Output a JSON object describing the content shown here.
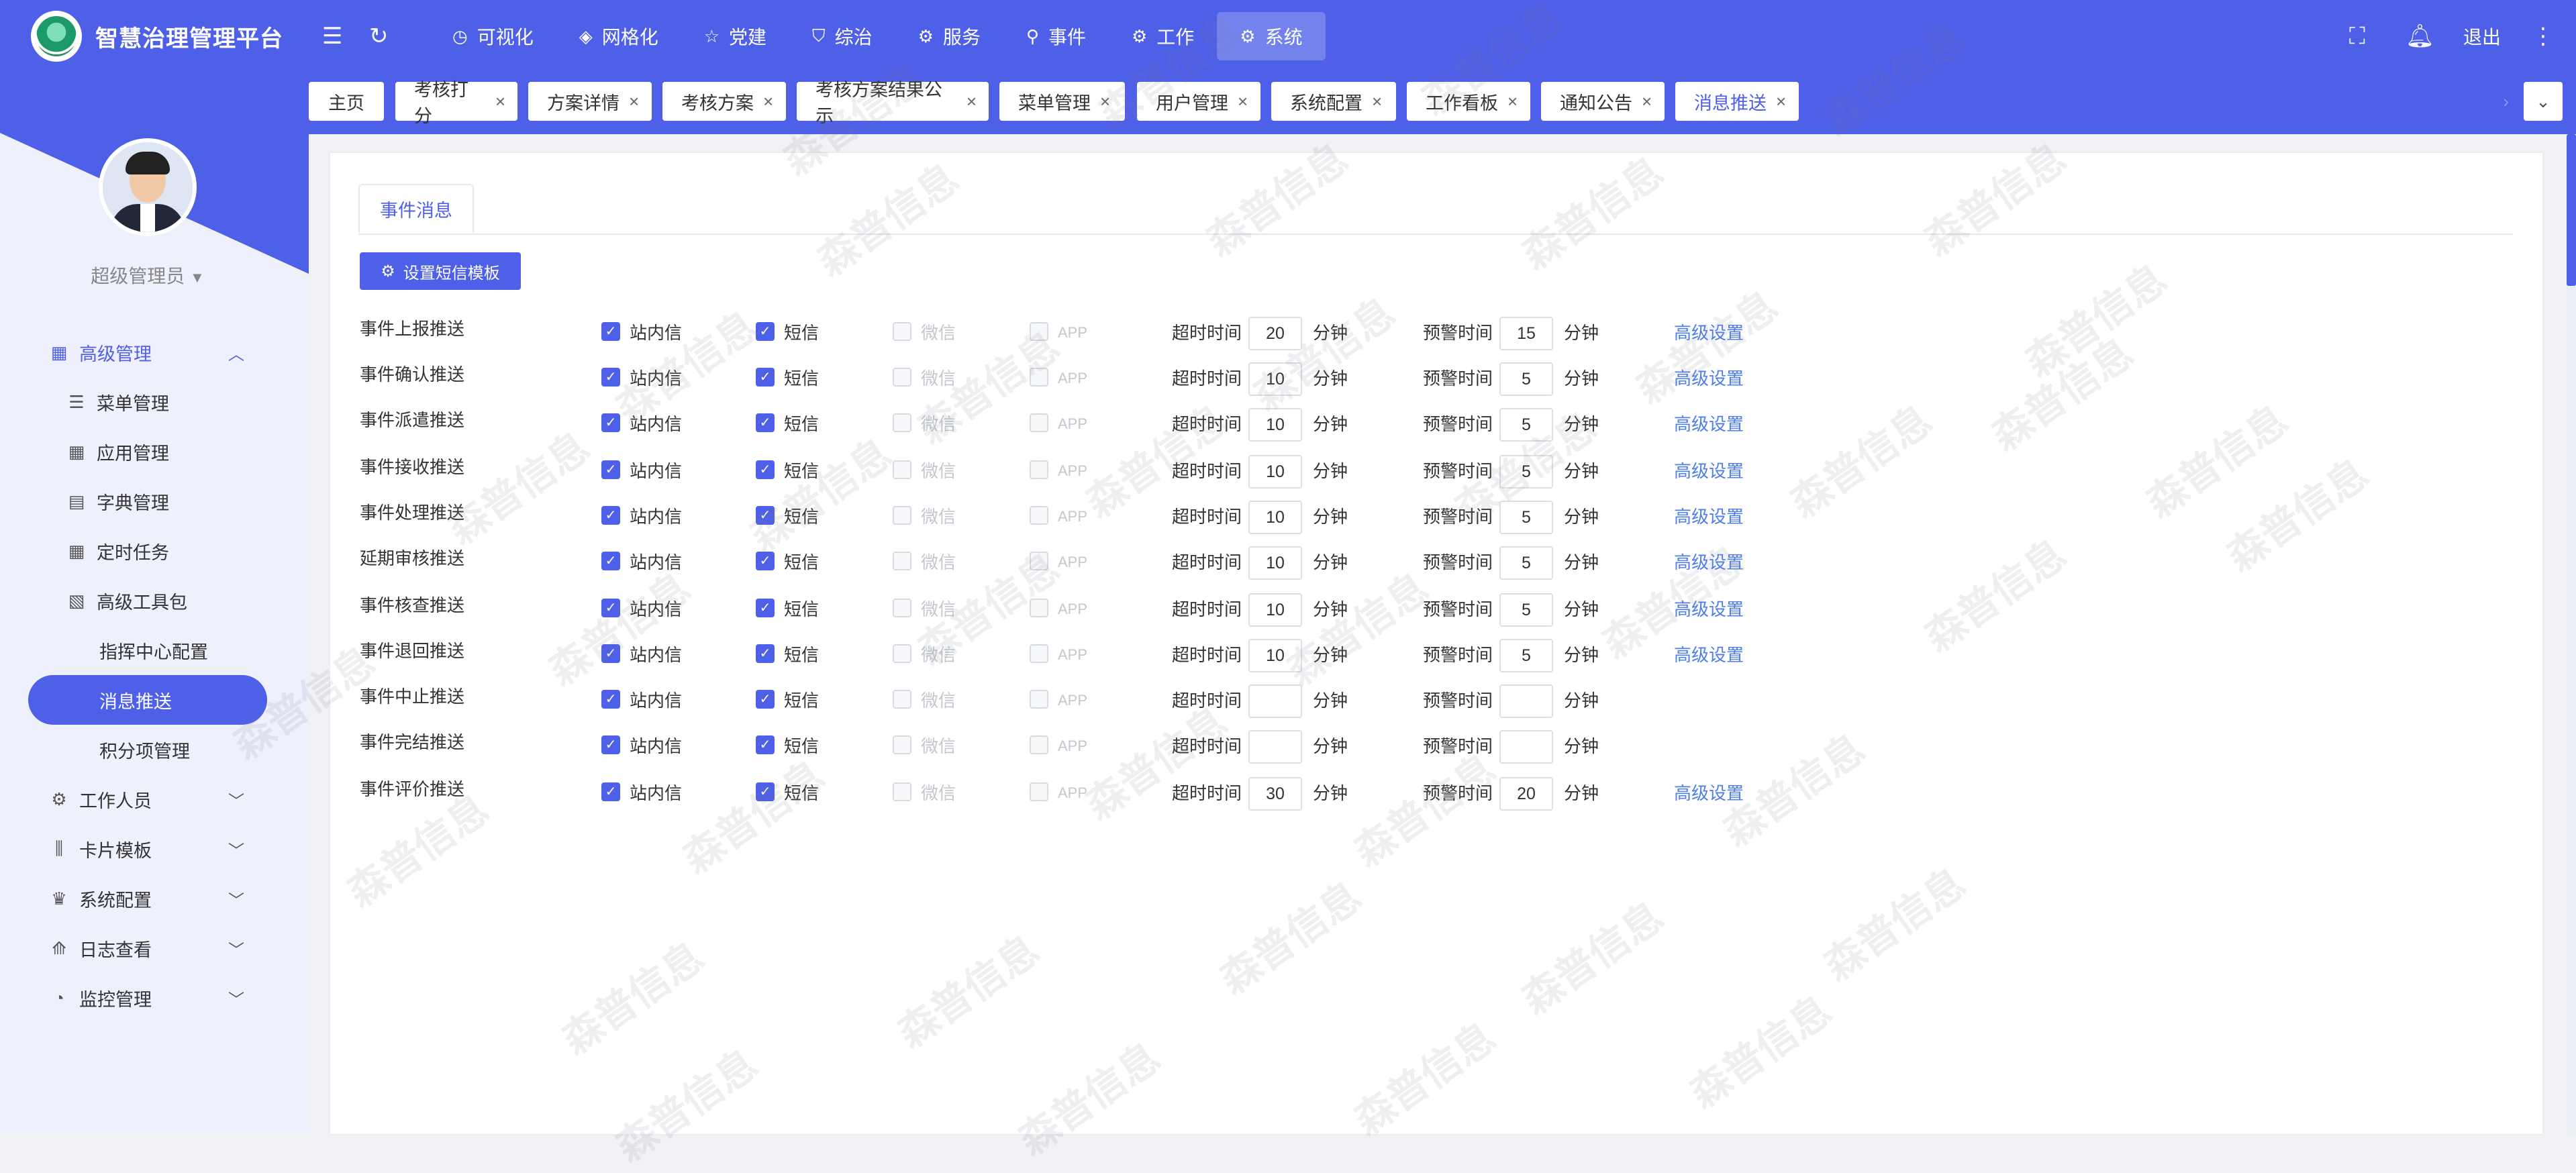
{
  "header": {
    "app_title": "智慧治理管理平台",
    "nav": [
      {
        "label": "可视化",
        "icon": "dashboard-icon"
      },
      {
        "label": "网格化",
        "icon": "grid-diamond-icon"
      },
      {
        "label": "党建",
        "icon": "star-icon"
      },
      {
        "label": "综治",
        "icon": "shield-icon"
      },
      {
        "label": "服务",
        "icon": "service-icon"
      },
      {
        "label": "事件",
        "icon": "location-pin-icon"
      },
      {
        "label": "工作",
        "icon": "work-icon"
      },
      {
        "label": "系统",
        "icon": "gear-icon",
        "active": true
      }
    ],
    "logout": "退出"
  },
  "sidebar": {
    "username": "超级管理员",
    "items": [
      {
        "label": "高级管理",
        "icon": "grid-icon",
        "level": 1,
        "open": true
      },
      {
        "label": "菜单管理",
        "icon": "list-icon",
        "level": 2
      },
      {
        "label": "应用管理",
        "icon": "apps-icon",
        "level": 2
      },
      {
        "label": "字典管理",
        "icon": "book-icon",
        "level": 2
      },
      {
        "label": "定时任务",
        "icon": "calendar-icon",
        "level": 2
      },
      {
        "label": "高级工具包",
        "icon": "toolkit-icon",
        "level": 2
      },
      {
        "label": "指挥中心配置",
        "level": 3
      },
      {
        "label": "消息推送",
        "level": 3,
        "selected": true
      },
      {
        "label": "积分项管理",
        "level": 3
      },
      {
        "label": "工作人员",
        "icon": "gear-icon",
        "level": 1
      },
      {
        "label": "卡片模板",
        "icon": "sliders-icon",
        "level": 1
      },
      {
        "label": "系统配置",
        "icon": "crown-icon",
        "level": 1
      },
      {
        "label": "日志查看",
        "icon": "chart-icon",
        "level": 1
      },
      {
        "label": "监控管理",
        "icon": "gauge-icon",
        "level": 1
      }
    ]
  },
  "tags": [
    {
      "label": "主页",
      "closable": false
    },
    {
      "label": "考核打分",
      "closable": true
    },
    {
      "label": "方案详情",
      "closable": true
    },
    {
      "label": "考核方案",
      "closable": true
    },
    {
      "label": "考核方案结果公示",
      "closable": true
    },
    {
      "label": "菜单管理",
      "closable": true
    },
    {
      "label": "用户管理",
      "closable": true
    },
    {
      "label": "系统配置",
      "closable": true
    },
    {
      "label": "工作看板",
      "closable": true
    },
    {
      "label": "通知公告",
      "closable": true
    },
    {
      "label": "消息推送",
      "closable": true,
      "active": true
    }
  ],
  "tab_label": "事件消息",
  "sms_button_label": "设置短信模板",
  "labels": {
    "site_msg": "站内信",
    "sms": "短信",
    "wechat": "微信",
    "app": "APP",
    "timeout": "超时时间",
    "warning": "预警时间",
    "minutes": "分钟",
    "advanced": "高级设置"
  },
  "rows": [
    {
      "name": "事件上报推送",
      "site": true,
      "sms": true,
      "wechat": false,
      "app": false,
      "timeout": "20",
      "warning": "15",
      "advanced": true
    },
    {
      "name": "事件确认推送",
      "site": true,
      "sms": true,
      "wechat": false,
      "app": false,
      "timeout": "10",
      "warning": "5",
      "advanced": true
    },
    {
      "name": "事件派遣推送",
      "site": true,
      "sms": true,
      "wechat": false,
      "app": false,
      "timeout": "10",
      "warning": "5",
      "advanced": true
    },
    {
      "name": "事件接收推送",
      "site": true,
      "sms": true,
      "wechat": false,
      "app": false,
      "timeout": "10",
      "warning": "5",
      "advanced": true
    },
    {
      "name": "事件处理推送",
      "site": true,
      "sms": true,
      "wechat": false,
      "app": false,
      "timeout": "10",
      "warning": "5",
      "advanced": true
    },
    {
      "name": "延期审核推送",
      "site": true,
      "sms": true,
      "wechat": false,
      "app": false,
      "timeout": "10",
      "warning": "5",
      "advanced": true
    },
    {
      "name": "事件核查推送",
      "site": true,
      "sms": true,
      "wechat": false,
      "app": false,
      "timeout": "10",
      "warning": "5",
      "advanced": true
    },
    {
      "name": "事件退回推送",
      "site": true,
      "sms": true,
      "wechat": false,
      "app": false,
      "timeout": "10",
      "warning": "5",
      "advanced": true
    },
    {
      "name": "事件中止推送",
      "site": true,
      "sms": true,
      "wechat": false,
      "app": false,
      "timeout": "",
      "warning": "",
      "advanced": false
    },
    {
      "name": "事件完结推送",
      "site": true,
      "sms": true,
      "wechat": false,
      "app": false,
      "timeout": "",
      "warning": "",
      "advanced": false
    },
    {
      "name": "事件评价推送",
      "site": true,
      "sms": true,
      "wechat": false,
      "app": false,
      "timeout": "30",
      "warning": "20",
      "advanced": true
    }
  ],
  "watermark": "森普信息",
  "colors": {
    "primary": "#4e5fe8",
    "link": "#4e7df0"
  }
}
